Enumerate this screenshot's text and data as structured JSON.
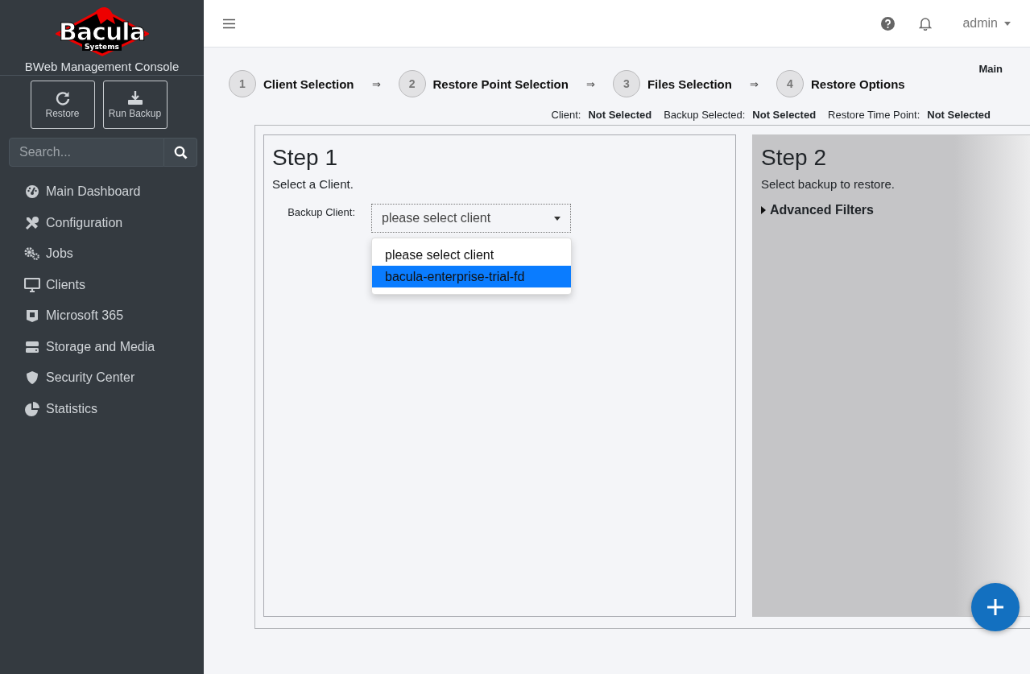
{
  "sidebar": {
    "logo": {
      "word": "Bacula",
      "sub": "Systems"
    },
    "title": "BWeb Management Console",
    "actions": [
      {
        "label": "Restore"
      },
      {
        "label": "Run Backup"
      }
    ],
    "search": {
      "placeholder": "Search..."
    },
    "items": [
      {
        "label": "Main Dashboard"
      },
      {
        "label": "Configuration"
      },
      {
        "label": "Jobs"
      },
      {
        "label": "Clients"
      },
      {
        "label": "Microsoft 365"
      },
      {
        "label": "Storage and Media"
      },
      {
        "label": "Security Center"
      },
      {
        "label": "Statistics"
      }
    ]
  },
  "topbar": {
    "user": "admin"
  },
  "breadcrumb": "Main",
  "steps": [
    {
      "number": "1",
      "label": "Client Selection",
      "arrow": "⇒"
    },
    {
      "number": "2",
      "label": "Restore Point Selection",
      "arrow": "⇒"
    },
    {
      "number": "3",
      "label": "Files Selection",
      "arrow": "⇒"
    },
    {
      "number": "4",
      "label": "Restore Options"
    }
  ],
  "summary": [
    {
      "label": "Client:",
      "value": "Not Selected"
    },
    {
      "label": "Backup Selected:",
      "value": "Not Selected"
    },
    {
      "label": "Restore Time Point:",
      "value": "Not Selected"
    }
  ],
  "panels": [
    {
      "kind": "client",
      "title": "Step 1",
      "subtitle": "Select a Client.",
      "field_label": "Backup Client:",
      "value": "please select client",
      "expanded": true,
      "options": [
        {
          "label": "please select client",
          "highlighted": false
        },
        {
          "label": "bacula-enterprise-trial-fd",
          "highlighted": true
        }
      ]
    },
    {
      "kind": "backup",
      "title": "Step 2",
      "subtitle": "Select backup to restore.",
      "filters": {
        "label": "Advanced Filters",
        "expanded": false
      }
    }
  ]
}
